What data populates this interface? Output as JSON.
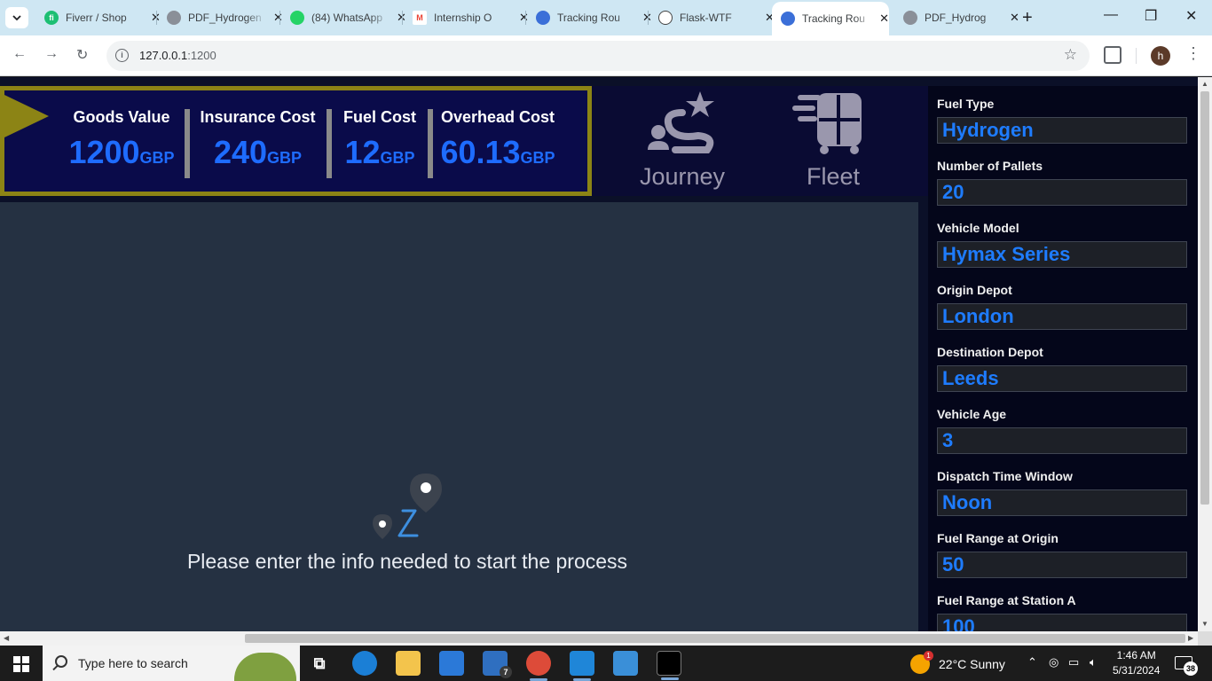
{
  "browser": {
    "tabs": [
      {
        "title": "Fiverr / Shop",
        "icon": "fiverr-icon",
        "color": "#1dbf73",
        "glyph": "fi"
      },
      {
        "title": "PDF_Hydrogen",
        "icon": "globe-icon",
        "color": "#8a8f98",
        "glyph": ""
      },
      {
        "title": "(84) WhatsApp",
        "icon": "whatsapp-icon",
        "color": "#25d366",
        "glyph": ""
      },
      {
        "title": "Internship O",
        "icon": "gmail-icon",
        "color": "#ea4335",
        "glyph": "M"
      },
      {
        "title": "Tracking Rou",
        "icon": "firefox-icon",
        "color": "#3b6fd8",
        "glyph": ""
      },
      {
        "title": "Flask-WTF",
        "icon": "chatgpt-icon",
        "color": "#444444",
        "glyph": ""
      },
      {
        "title": "Tracking Rou",
        "icon": "firefox-icon",
        "color": "#3b6fd8",
        "glyph": "",
        "active": true
      },
      {
        "title": "PDF_Hydrog",
        "icon": "globe-icon",
        "color": "#8a8f98",
        "glyph": ""
      }
    ],
    "url": {
      "host": "127.0.0.1",
      "port": ":1200"
    },
    "profile_initial": "h"
  },
  "costs": {
    "goods_value": {
      "label": "Goods Value",
      "value": "1200",
      "unit": "GBP"
    },
    "insurance_cost": {
      "label": "Insurance Cost",
      "value": "240",
      "unit": "GBP"
    },
    "fuel_cost": {
      "label": "Fuel Cost",
      "value": "12",
      "unit": "GBP"
    },
    "overhead_cost": {
      "label": "Overhead Cost",
      "value": "60.13",
      "unit": "GBP"
    }
  },
  "nav": {
    "journey": "Journey",
    "fleet": "Fleet"
  },
  "map": {
    "message": "Please enter the info needed to start the process"
  },
  "form": {
    "fields": [
      {
        "label": "Fuel Type",
        "value": "Hydrogen"
      },
      {
        "label": "Number of Pallets",
        "value": "20"
      },
      {
        "label": "Vehicle Model",
        "value": "Hymax Series"
      },
      {
        "label": "Origin Depot",
        "value": "London"
      },
      {
        "label": "Destination Depot",
        "value": "Leeds"
      },
      {
        "label": "Vehicle Age",
        "value": "3"
      },
      {
        "label": "Dispatch Time Window",
        "value": "Noon"
      },
      {
        "label": "Fuel Range at Origin",
        "value": "50"
      },
      {
        "label": "Fuel Range at Station A",
        "value": "100"
      }
    ]
  },
  "taskbar": {
    "search_placeholder": "Type here to search",
    "weather": "22°C  Sunny",
    "time": "1:46 AM",
    "date": "5/31/2024",
    "mail_badge": "7",
    "notification_count": "38"
  },
  "colors": {
    "accent_blue": "#1e6cff",
    "panel_border": "#8c8415",
    "panel_bg": "#0a0b4a",
    "sidebar_bg": "#04061a",
    "map_bg": "#253142"
  }
}
